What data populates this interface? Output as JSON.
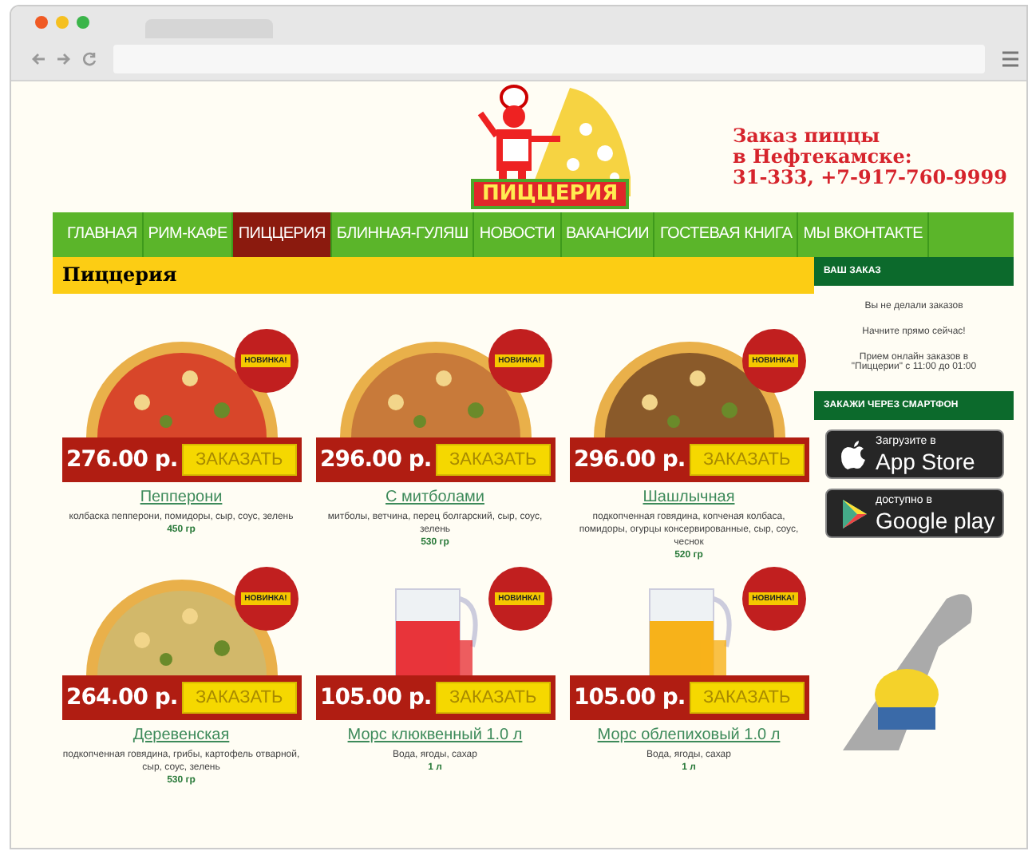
{
  "logo": {
    "text": "ПИЦЦЕРИЯ"
  },
  "header": {
    "lines": [
      "Заказ пиццы",
      "в Нефтекамске:",
      "31-333, +7-917-760-9999"
    ]
  },
  "nav": [
    {
      "label": "ГЛАВНАЯ",
      "selected": false
    },
    {
      "label": "РИМ-КАФЕ",
      "selected": false
    },
    {
      "label": "ПИЦЦЕРИЯ",
      "selected": true
    },
    {
      "label": "БЛИННАЯ-ГУЛЯШ",
      "selected": false
    },
    {
      "label": "НОВОСТИ",
      "selected": false
    },
    {
      "label": "ВАКАНСИИ",
      "selected": false
    },
    {
      "label": "ГОСТЕВАЯ КНИГА",
      "selected": false
    },
    {
      "label": "МЫ ВКОНТАКТЕ",
      "selected": false
    }
  ],
  "page_title": "Пиццерия",
  "products": [
    {
      "kind": "pizza",
      "badge": "НОВИНКА!",
      "price": "276.00 р.",
      "button": "ЗАКАЗАТЬ",
      "name": "Пепперони",
      "description": "колбаска пепперони, помидоры, сыр, соус, зелень",
      "weight": "450 гр"
    },
    {
      "kind": "pizza",
      "badge": "НОВИНКА!",
      "price": "296.00 р.",
      "button": "ЗАКАЗАТЬ",
      "name": "С митболами",
      "description": "митболы, ветчина, перец болгарский, сыр, соус, зелень",
      "weight": "530 гр"
    },
    {
      "kind": "pizza",
      "badge": "НОВИНКА!",
      "price": "296.00 р.",
      "button": "ЗАКАЗАТЬ",
      "name": "Шашлычная",
      "description": "подкопченная говядина, копченая колбаса, помидоры, огурцы консервированные, сыр, соус, чеснок",
      "weight": "520 гр"
    },
    {
      "kind": "pizza",
      "badge": "НОВИНКА!",
      "price": "264.00 р.",
      "button": "ЗАКАЗАТЬ",
      "name": "Деревенская",
      "description": "подкопченная говядина, грибы, картофель отварной, сыр, соус, зелень",
      "weight": "530 гр"
    },
    {
      "kind": "drink",
      "badge": "НОВИНКА!",
      "price": "105.00 р.",
      "button": "ЗАКАЗАТЬ",
      "name": "Морс клюквенный 1.0 л",
      "description": "Вода, ягоды, сахар",
      "weight": "1 л"
    },
    {
      "kind": "drink",
      "badge": "НОВИНКА!",
      "price": "105.00 р.",
      "button": "ЗАКАЗАТЬ",
      "name": "Морс облепиховый 1.0 л",
      "description": "Вода, ягоды, сахар",
      "weight": "1 л"
    }
  ],
  "sidebar": {
    "order_title": "ВАШ ЗАКАЗ",
    "order_lines": [
      "Вы не делали заказов",
      "Начните прямо сейчас!",
      "Прием онлайн заказов в \"Пиццерии\" с 11:00 до 01:00"
    ],
    "smartphone_title": "ЗАКАЖИ ЧЕРЕЗ СМАРТФОН",
    "stores": [
      {
        "kind": "apple",
        "small": "Загрузите в",
        "big": "App Store"
      },
      {
        "kind": "google",
        "small": "доступно в",
        "big": "Google play"
      }
    ]
  }
}
